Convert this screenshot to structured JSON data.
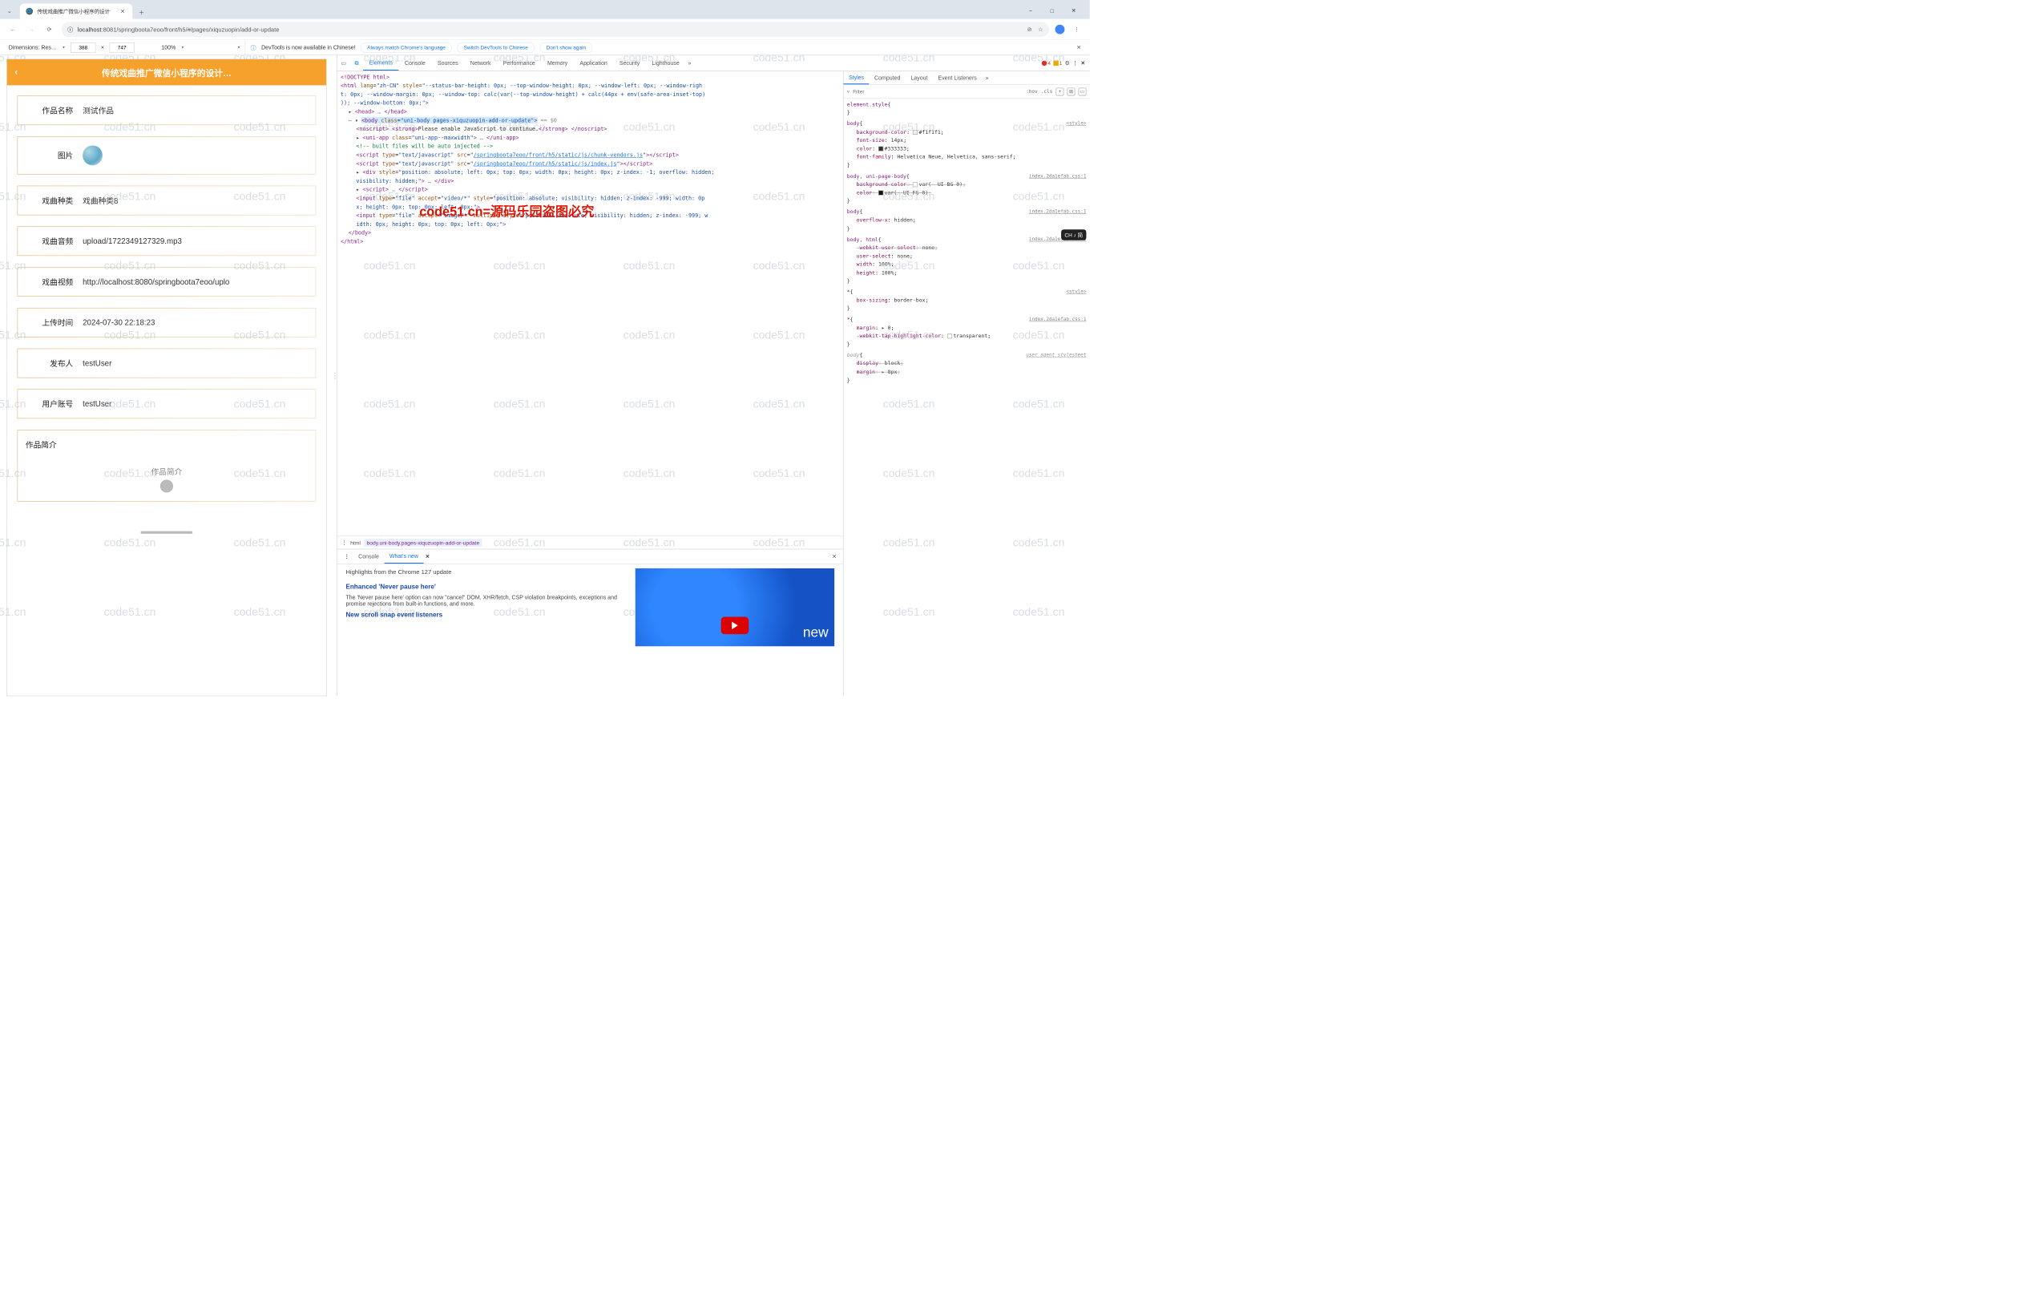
{
  "tab": {
    "title": "传统戏曲推广微信小程序的设计",
    "favicon_glyph": "🌐"
  },
  "window_controls": {
    "min": "−",
    "max": "□",
    "close": "✕"
  },
  "nav": {
    "back": "‹",
    "forward": "›",
    "reload": "⟳",
    "url_info_icon": "ⓘ",
    "url_host": "localhost",
    "url_path": ":8081/springboota7eoo/front/h5/#/pages/xiquzuopin/add-or-update",
    "key_icon": "⊘",
    "star_icon": "☆"
  },
  "dimbar": {
    "label": "Dimensions: Res…",
    "width": "388",
    "times": "×",
    "height": "747",
    "zoom": "100%",
    "devtools_cn": "DevTools is now available in Chinese!",
    "pill_always": "Always match Chrome's language",
    "pill_switch": "Switch DevTools to Chinese",
    "pill_dont": "Don't show again"
  },
  "mobile": {
    "header_title": "传统戏曲推广微信小程序的设计…",
    "fields": [
      {
        "label": "作品名称",
        "value": "测试作品"
      },
      {
        "label": "图片",
        "value": "__IMAGE__"
      },
      {
        "label": "戏曲种类",
        "value": "戏曲种类8"
      },
      {
        "label": "戏曲音频",
        "value": "upload/1722349127329.mp3"
      },
      {
        "label": "戏曲视频",
        "value": "http://localhost:8080/springboota7eoo/uplo"
      },
      {
        "label": "上传时间",
        "value": "2024-07-30 22:18:23"
      },
      {
        "label": "发布人",
        "value": "testUser"
      },
      {
        "label": "用户账号",
        "value": "testUser"
      },
      {
        "label": "作品简介",
        "value": "__TEXTAREA__"
      }
    ],
    "textarea_placeholder": "作品简介"
  },
  "devtools": {
    "tabs": [
      "Elements",
      "Console",
      "Sources",
      "Network",
      "Performance",
      "Memory",
      "Application",
      "Security",
      "Lighthouse"
    ],
    "active_tab": "Elements",
    "error_count": "4",
    "warning_count": "1",
    "styles_tabs": [
      "Styles",
      "Computed",
      "Layout",
      "Event Listeners"
    ],
    "styles_active": "Styles",
    "filter_placeholder": "Filter",
    "hov_label": ":hov",
    "cls_label": ".cls",
    "dom_lines": [
      {
        "i": 0,
        "html": "<span class='tag'>&lt;!DOCTYPE html&gt;</span>"
      },
      {
        "i": 0,
        "html": "<span class='tag'>&lt;html</span> <span class='attr'>lang</span>=<span class='str'>\"zh-CN\"</span> <span class='attr'>style</span>=<span class='str'>\"--status-bar-height: 0px; --top-window-height: 0px; --window-left: 0px; --window-righ</span>"
      },
      {
        "i": 0,
        "html": "<span class='str'>t: 0px; --window-margin: 0px; --window-top: calc(var(--top-window-height) + calc(44px + env(safe-area-inset-top)</span>"
      },
      {
        "i": 0,
        "html": "<span class='str'>)); --window-bottom: 0px;\"</span><span class='tag'>&gt;</span>"
      },
      {
        "i": 1,
        "html": "▸ <span class='tag'>&lt;head&gt;</span> <span class='ghost'>…</span> <span class='tag'>&lt;/head&gt;</span>"
      },
      {
        "i": 1,
        "html": "<span class='ghost'>⋯</span> ▾ <span class='sel'><span class='tag'>&lt;body</span> <span class='attr'>class</span>=<span class='str'>\"uni-body pages-xiquzuopin-add-or-update\"</span><span class='tag'>&gt;</span></span> <span class='ghost'>== $0</span>"
      },
      {
        "i": 2,
        "html": "<span class='tag'>&lt;noscript&gt;</span> <span class='tag'>&lt;strong&gt;</span>Please enable JavaScript to continue.<span class='tag'>&lt;/strong&gt;</span> <span class='tag'>&lt;/noscript&gt;</span>"
      },
      {
        "i": 2,
        "html": "▸ <span class='tag'>&lt;uni-app</span> <span class='attr'>class</span>=<span class='str'>\"uni-app--maxwidth\"</span><span class='tag'>&gt;</span> <span class='ghost'>…</span> <span class='tag'>&lt;/uni-app&gt;</span>"
      },
      {
        "i": 2,
        "html": "<span class='comment'>&lt;!-- built files will be auto injected --&gt;</span>"
      },
      {
        "i": 2,
        "html": "<span class='tag'>&lt;script</span> <span class='attr'>type</span>=<span class='str'>\"text/javascript\"</span> <span class='attr'>src</span>=\"<span class='lnk'>/springboota7eoo/front/h5/static/js/chunk-vendors.js</span>\"<span class='tag'>&gt;&lt;/script&gt;</span>"
      },
      {
        "i": 2,
        "html": "<span class='tag'>&lt;script</span> <span class='attr'>type</span>=<span class='str'>\"text/javascript\"</span> <span class='attr'>src</span>=\"<span class='lnk'>/springboota7eoo/front/h5/static/js/index.js</span>\"<span class='tag'>&gt;&lt;/script&gt;</span>"
      },
      {
        "i": 2,
        "html": "▸ <span class='tag'>&lt;div</span> <span class='attr'>style</span>=<span class='str'>\"position: absolute; left: 0px; top: 0px; width: 0px; height: 0px; z-index: -1; overflow: hidden;</span>"
      },
      {
        "i": 2,
        "html": "<span class='str'>visibility: hidden;\"</span><span class='tag'>&gt;</span> <span class='ghost'>…</span> <span class='tag'>&lt;/div&gt;</span>"
      },
      {
        "i": 2,
        "html": "▸ <span class='tag'>&lt;script&gt;</span> <span class='ghost'>…</span> <span class='tag'>&lt;/script&gt;</span>"
      },
      {
        "i": 2,
        "html": "<span class='tag'>&lt;input</span> <span class='attr'>type</span>=<span class='str'>\"file\"</span> <span class='attr'>accept</span>=<span class='str'>\"video/*\"</span> <span class='attr'>style</span>=<span class='str'>\"position: absolute; visibility: hidden; z-index: -999; width: 0p</span>"
      },
      {
        "i": 2,
        "html": "<span class='str'>x; height: 0px; top: 0px; left: 0px;\"</span><span class='tag'>&gt;</span>"
      },
      {
        "i": 2,
        "html": "<span class='tag'>&lt;input</span> <span class='attr'>type</span>=<span class='str'>\"file\"</span> <span class='attr'>accept</span>=<span class='str'>\"image/*\"</span> <span class='attr'>multiple style</span>=<span class='str'>\"position: absolute; visibility: hidden; z-index: -999; w</span>"
      },
      {
        "i": 2,
        "html": "<span class='str'>idth: 0px; height: 0px; top: 0px; left: 0px;\"</span><span class='tag'>&gt;</span>"
      },
      {
        "i": 1,
        "html": "<span class='tag'>&lt;/body&gt;</span>"
      },
      {
        "i": 0,
        "html": "<span class='tag'>&lt;/html&gt;</span>"
      }
    ],
    "breadcrumb": [
      "html",
      "body.uni-body.pages-xiquzuopin-add-or-update"
    ],
    "style_rules": [
      {
        "sel": "element.style",
        "src": "",
        "props": []
      },
      {
        "sel": "body",
        "src": "<style>",
        "props": [
          {
            "n": "background-color",
            "v": "#f1f1f1",
            "sw": "#f1f1f1"
          },
          {
            "n": "font-size",
            "v": "14px"
          },
          {
            "n": "color",
            "v": "#333333",
            "sw": "#333333"
          },
          {
            "n": "font-family",
            "v": "Helvetica Neue, Helvetica, sans-serif"
          }
        ]
      },
      {
        "sel": "body, uni-page-body",
        "src": "index.2da1efab.css:1",
        "props": [
          {
            "n": "background-color",
            "v": "var(--UI-BG-0)",
            "struck": true,
            "sw": "#fff"
          },
          {
            "n": "color",
            "v": "var(--UI-FG-0)",
            "struck": true,
            "sw": "#111"
          }
        ]
      },
      {
        "sel": "body",
        "src": "index.2da1efab.css:1",
        "props": [
          {
            "n": "overflow-x",
            "v": "hidden"
          }
        ]
      },
      {
        "sel": "body, html",
        "src": "index.2da1efab.css:1",
        "props": [
          {
            "n": "-webkit-user-select",
            "v": "none",
            "struck": true
          },
          {
            "n": "user-select",
            "v": "none"
          },
          {
            "n": "width",
            "v": "100%"
          },
          {
            "n": "height",
            "v": "100%"
          }
        ]
      },
      {
        "sel": "*",
        "src": "<style>",
        "props": [
          {
            "n": "box-sizing",
            "v": "border-box"
          }
        ]
      },
      {
        "sel": "*",
        "src": "index.2da1efab.css:1",
        "props": [
          {
            "n": "margin",
            "v": "▸ 0"
          },
          {
            "n": "-webkit-tap-highlight-color",
            "v": "transparent",
            "sw": "#ffffff00"
          }
        ]
      },
      {
        "sel": "body",
        "src": "user agent stylesheet",
        "italic": true,
        "props": [
          {
            "n": "display",
            "v": "block",
            "struck": true
          },
          {
            "n": "margin",
            "v": "▸ 8px",
            "struck": true
          }
        ]
      }
    ],
    "drawer": {
      "tabs": [
        "Console",
        "What's new"
      ],
      "active": "What's new",
      "headline": "Highlights from the Chrome 127 update",
      "h1": "Enhanced 'Never pause here'",
      "p1": "The 'Never pause here' option can now \"cancel\" DOM, XHR/fetch, CSP violation breakpoints, exceptions and promise rejections from built-in functions, and more.",
      "h2": "New scroll snap event listeners",
      "thumb_text": "new"
    }
  },
  "watermark_text": "code51.cn",
  "overlay_text": "code51.cn=源码乐园盗图必究",
  "ch_pill": "CH ♪ 简"
}
